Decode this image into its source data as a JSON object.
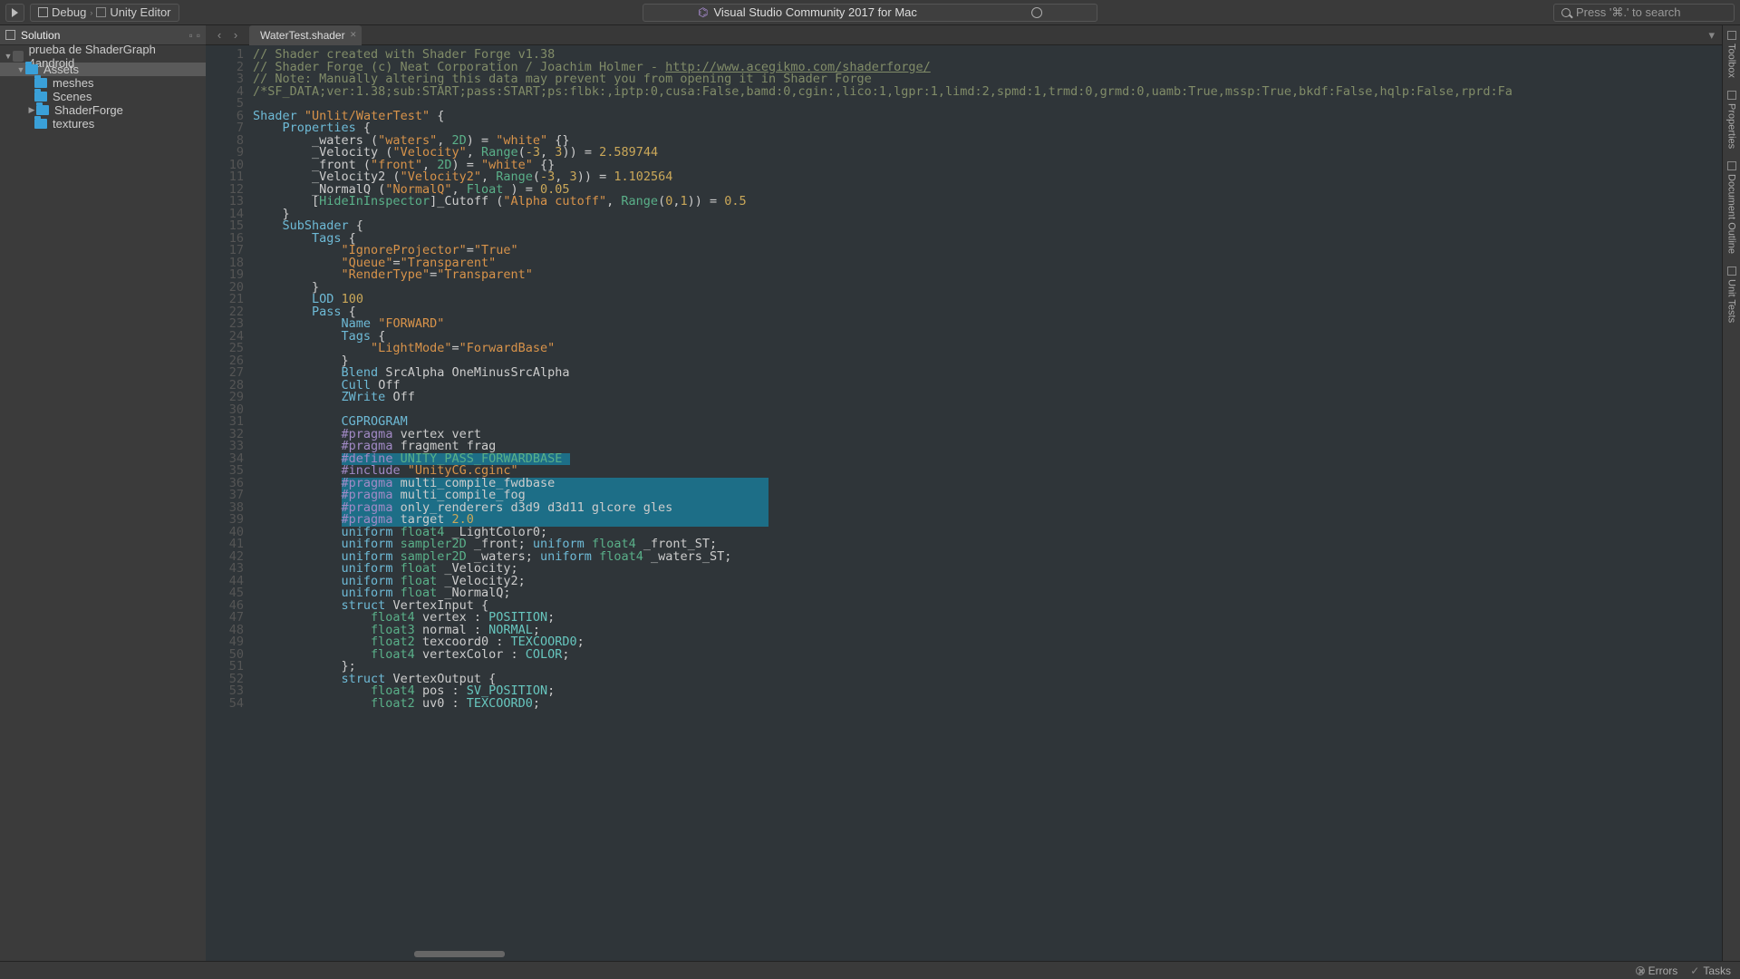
{
  "toolbar": {
    "debug_label": "Debug",
    "target_label": "Unity Editor",
    "app_title": "Visual Studio Community 2017 for Mac",
    "search_placeholder": "Press '⌘.' to search"
  },
  "solution": {
    "pane_title": "Solution",
    "project": "prueba de ShaderGraph 4android",
    "folders": [
      "Assets",
      "meshes",
      "Scenes",
      "ShaderForge",
      "textures"
    ]
  },
  "tab": {
    "filename": "WaterTest.shader"
  },
  "rail": {
    "items": [
      "Toolbox",
      "Properties",
      "Document Outline",
      "Unit Tests"
    ]
  },
  "status": {
    "errors": "Errors",
    "tasks": "Tasks"
  },
  "code": {
    "lines": [
      {
        "n": 1,
        "seg": [
          [
            "c",
            "// Shader created with Shader Forge v1.38 "
          ]
        ]
      },
      {
        "n": 2,
        "seg": [
          [
            "c",
            "// Shader Forge (c) Neat Corporation / Joachim Holmer - "
          ],
          [
            "cu",
            "http://www.acegikmo.com/shaderforge/"
          ]
        ]
      },
      {
        "n": 3,
        "seg": [
          [
            "c",
            "// Note: Manually altering this data may prevent you from opening it in Shader Forge"
          ]
        ]
      },
      {
        "n": 4,
        "seg": [
          [
            "c",
            "/*SF_DATA;ver:1.38;sub:START;pass:START;ps:flbk:,iptp:0,cusa:False,bamd:0,cgin:,lico:1,lgpr:1,limd:2,spmd:1,trmd:0,grmd:0,uamb:True,mssp:True,bkdf:False,hqlp:False,rprd:Fa"
          ]
        ]
      },
      {
        "n": 5,
        "seg": [
          [
            "",
            ""
          ]
        ]
      },
      {
        "n": 6,
        "seg": [
          [
            "k",
            "Shader"
          ],
          [
            "",
            " "
          ],
          [
            "s",
            "\"Unlit/WaterTest\""
          ],
          [
            "",
            " {"
          ]
        ]
      },
      {
        "n": 7,
        "seg": [
          [
            "",
            "    "
          ],
          [
            "k",
            "Properties"
          ],
          [
            "",
            " {"
          ]
        ]
      },
      {
        "n": 8,
        "seg": [
          [
            "",
            "        _waters ("
          ],
          [
            "s",
            "\"waters\""
          ],
          [
            "",
            ", "
          ],
          [
            "t",
            "2D"
          ],
          [
            "",
            ") = "
          ],
          [
            "s",
            "\"white\""
          ],
          [
            "",
            " {}"
          ]
        ]
      },
      {
        "n": 9,
        "seg": [
          [
            "",
            "        _Velocity ("
          ],
          [
            "s",
            "\"Velocity\""
          ],
          [
            "",
            ", "
          ],
          [
            "t",
            "Range"
          ],
          [
            "",
            "("
          ],
          [
            "n",
            "-3"
          ],
          [
            "",
            ", "
          ],
          [
            "n",
            "3"
          ],
          [
            "",
            ")) = "
          ],
          [
            "n",
            "2.589744"
          ]
        ]
      },
      {
        "n": 10,
        "seg": [
          [
            "",
            "        _front ("
          ],
          [
            "s",
            "\"front\""
          ],
          [
            "",
            ", "
          ],
          [
            "t",
            "2D"
          ],
          [
            "",
            ") = "
          ],
          [
            "s",
            "\"white\""
          ],
          [
            "",
            " {}"
          ]
        ]
      },
      {
        "n": 11,
        "seg": [
          [
            "",
            "        _Velocity2 ("
          ],
          [
            "s",
            "\"Velocity2\""
          ],
          [
            "",
            ", "
          ],
          [
            "t",
            "Range"
          ],
          [
            "",
            "("
          ],
          [
            "n",
            "-3"
          ],
          [
            "",
            ", "
          ],
          [
            "n",
            "3"
          ],
          [
            "",
            ")) = "
          ],
          [
            "n",
            "1.102564"
          ]
        ]
      },
      {
        "n": 12,
        "seg": [
          [
            "",
            "        _NormalQ ("
          ],
          [
            "s",
            "\"NormalQ\""
          ],
          [
            "",
            ", "
          ],
          [
            "t",
            "Float"
          ],
          [
            "",
            " ) = "
          ],
          [
            "n",
            "0.05"
          ]
        ]
      },
      {
        "n": 13,
        "seg": [
          [
            "",
            "        ["
          ],
          [
            "t",
            "HideInInspector"
          ],
          [
            "",
            "]_Cutoff ("
          ],
          [
            "s",
            "\"Alpha cutoff\""
          ],
          [
            "",
            ", "
          ],
          [
            "t",
            "Range"
          ],
          [
            "",
            "("
          ],
          [
            "n",
            "0"
          ],
          [
            "",
            ","
          ],
          [
            "n",
            "1"
          ],
          [
            "",
            ")) = "
          ],
          [
            "n",
            "0.5"
          ]
        ]
      },
      {
        "n": 14,
        "seg": [
          [
            "",
            "    }"
          ]
        ]
      },
      {
        "n": 15,
        "seg": [
          [
            "",
            "    "
          ],
          [
            "k",
            "SubShader"
          ],
          [
            "",
            " {"
          ]
        ]
      },
      {
        "n": 16,
        "seg": [
          [
            "",
            "        "
          ],
          [
            "k",
            "Tags"
          ],
          [
            "",
            " {"
          ]
        ]
      },
      {
        "n": 17,
        "seg": [
          [
            "",
            "            "
          ],
          [
            "s",
            "\"IgnoreProjector\""
          ],
          [
            "",
            "="
          ],
          [
            "s",
            "\"True\""
          ]
        ]
      },
      {
        "n": 18,
        "seg": [
          [
            "",
            "            "
          ],
          [
            "s",
            "\"Queue\""
          ],
          [
            "",
            "="
          ],
          [
            "s",
            "\"Transparent\""
          ]
        ]
      },
      {
        "n": 19,
        "seg": [
          [
            "",
            "            "
          ],
          [
            "s",
            "\"RenderType\""
          ],
          [
            "",
            "="
          ],
          [
            "s",
            "\"Transparent\""
          ]
        ]
      },
      {
        "n": 20,
        "seg": [
          [
            "",
            "        }"
          ]
        ]
      },
      {
        "n": 21,
        "seg": [
          [
            "",
            "        "
          ],
          [
            "k",
            "LOD"
          ],
          [
            "",
            " "
          ],
          [
            "n",
            "100"
          ]
        ]
      },
      {
        "n": 22,
        "seg": [
          [
            "",
            "        "
          ],
          [
            "k",
            "Pass"
          ],
          [
            "",
            " {"
          ]
        ]
      },
      {
        "n": 23,
        "seg": [
          [
            "",
            "            "
          ],
          [
            "k",
            "Name"
          ],
          [
            "",
            " "
          ],
          [
            "s",
            "\"FORWARD\""
          ]
        ]
      },
      {
        "n": 24,
        "seg": [
          [
            "",
            "            "
          ],
          [
            "k",
            "Tags"
          ],
          [
            "",
            " {"
          ]
        ]
      },
      {
        "n": 25,
        "seg": [
          [
            "",
            "                "
          ],
          [
            "s",
            "\"LightMode\""
          ],
          [
            "",
            "="
          ],
          [
            "s",
            "\"ForwardBase\""
          ]
        ]
      },
      {
        "n": 26,
        "seg": [
          [
            "",
            "            }"
          ]
        ]
      },
      {
        "n": 27,
        "seg": [
          [
            "",
            "            "
          ],
          [
            "k",
            "Blend"
          ],
          [
            "",
            " SrcAlpha OneMinusSrcAlpha"
          ]
        ]
      },
      {
        "n": 28,
        "seg": [
          [
            "",
            "            "
          ],
          [
            "k",
            "Cull"
          ],
          [
            "",
            " Off"
          ]
        ]
      },
      {
        "n": 29,
        "seg": [
          [
            "",
            "            "
          ],
          [
            "k",
            "ZWrite"
          ],
          [
            "",
            " Off"
          ]
        ]
      },
      {
        "n": 30,
        "seg": [
          [
            "",
            "            "
          ]
        ]
      },
      {
        "n": 31,
        "seg": [
          [
            "",
            "            "
          ],
          [
            "k",
            "CGPROGRAM"
          ]
        ]
      },
      {
        "n": 32,
        "seg": [
          [
            "",
            "            "
          ],
          [
            "p",
            "#pragma"
          ],
          [
            "",
            " vertex vert"
          ]
        ]
      },
      {
        "n": 33,
        "seg": [
          [
            "",
            "            "
          ],
          [
            "p",
            "#pragma"
          ],
          [
            "",
            " fragment frag"
          ]
        ]
      },
      {
        "n": 34,
        "seg": [
          [
            "",
            "            "
          ],
          [
            "selstart",
            ""
          ],
          [
            "p",
            "#define"
          ],
          [
            "",
            " "
          ],
          [
            "t",
            "UNITY_PASS_FORWARDBASE"
          ],
          [
            "",
            " "
          ],
          [
            "selend",
            ""
          ]
        ]
      },
      {
        "n": 35,
        "seg": [
          [
            "",
            "            "
          ],
          [
            "p",
            "#include"
          ],
          [
            "",
            " "
          ],
          [
            "s",
            "\"UnityCG.cginc\""
          ]
        ]
      },
      {
        "n": 36,
        "seg": [
          [
            "",
            "            "
          ],
          [
            "selstart",
            ""
          ],
          [
            "p",
            "#pragma"
          ],
          [
            "",
            " multi_compile_fwdbase                             "
          ],
          [
            "selend",
            ""
          ]
        ]
      },
      {
        "n": 37,
        "seg": [
          [
            "",
            "            "
          ],
          [
            "selstart",
            ""
          ],
          [
            "p",
            "#pragma"
          ],
          [
            "",
            " multi_compile_fog                                 "
          ],
          [
            "selend",
            ""
          ]
        ]
      },
      {
        "n": 38,
        "seg": [
          [
            "",
            "            "
          ],
          [
            "selstart",
            ""
          ],
          [
            "p",
            "#pragma"
          ],
          [
            "",
            " only_renderers d3d9 d3d11 glcore gles             "
          ],
          [
            "selend",
            ""
          ]
        ]
      },
      {
        "n": 39,
        "seg": [
          [
            "",
            "            "
          ],
          [
            "selstart",
            ""
          ],
          [
            "p",
            "#pragma"
          ],
          [
            "",
            " target "
          ],
          [
            "n",
            "2.0"
          ],
          [
            "",
            "                                        "
          ],
          [
            "selend",
            ""
          ]
        ]
      },
      {
        "n": 40,
        "seg": [
          [
            "",
            "            "
          ],
          [
            "k",
            "uniform"
          ],
          [
            "",
            " "
          ],
          [
            "t",
            "float4"
          ],
          [
            "",
            " _LightColor0;"
          ]
        ]
      },
      {
        "n": 41,
        "seg": [
          [
            "",
            "            "
          ],
          [
            "k",
            "uniform"
          ],
          [
            "",
            " "
          ],
          [
            "t",
            "sampler2D"
          ],
          [
            "",
            " _front; "
          ],
          [
            "k",
            "uniform"
          ],
          [
            "",
            " "
          ],
          [
            "t",
            "float4"
          ],
          [
            "",
            " _front_ST;"
          ]
        ]
      },
      {
        "n": 42,
        "seg": [
          [
            "",
            "            "
          ],
          [
            "k",
            "uniform"
          ],
          [
            "",
            " "
          ],
          [
            "t",
            "sampler2D"
          ],
          [
            "",
            " _waters; "
          ],
          [
            "k",
            "uniform"
          ],
          [
            "",
            " "
          ],
          [
            "t",
            "float4"
          ],
          [
            "",
            " _waters_ST;"
          ]
        ]
      },
      {
        "n": 43,
        "seg": [
          [
            "",
            "            "
          ],
          [
            "k",
            "uniform"
          ],
          [
            "",
            " "
          ],
          [
            "t",
            "float"
          ],
          [
            "",
            " _Velocity;"
          ]
        ]
      },
      {
        "n": 44,
        "seg": [
          [
            "",
            "            "
          ],
          [
            "k",
            "uniform"
          ],
          [
            "",
            " "
          ],
          [
            "t",
            "float"
          ],
          [
            "",
            " _Velocity2;"
          ]
        ]
      },
      {
        "n": 45,
        "seg": [
          [
            "",
            "            "
          ],
          [
            "k",
            "uniform"
          ],
          [
            "",
            " "
          ],
          [
            "t",
            "float"
          ],
          [
            "",
            " _NormalQ;"
          ]
        ]
      },
      {
        "n": 46,
        "seg": [
          [
            "",
            "            "
          ],
          [
            "k",
            "struct"
          ],
          [
            "",
            " VertexInput {"
          ]
        ]
      },
      {
        "n": 47,
        "seg": [
          [
            "",
            "                "
          ],
          [
            "t",
            "float4"
          ],
          [
            "",
            " vertex : "
          ],
          [
            "sm",
            "POSITION"
          ],
          [
            "",
            ";"
          ]
        ]
      },
      {
        "n": 48,
        "seg": [
          [
            "",
            "                "
          ],
          [
            "t",
            "float3"
          ],
          [
            "",
            " normal : "
          ],
          [
            "sm",
            "NORMAL"
          ],
          [
            "",
            ";"
          ]
        ]
      },
      {
        "n": 49,
        "seg": [
          [
            "",
            "                "
          ],
          [
            "t",
            "float2"
          ],
          [
            "",
            " texcoord0 : "
          ],
          [
            "sm",
            "TEXCOORD0"
          ],
          [
            "",
            ";"
          ]
        ]
      },
      {
        "n": 50,
        "seg": [
          [
            "",
            "                "
          ],
          [
            "t",
            "float4"
          ],
          [
            "",
            " vertexColor : "
          ],
          [
            "sm",
            "COLOR"
          ],
          [
            "",
            ";"
          ]
        ]
      },
      {
        "n": 51,
        "seg": [
          [
            "",
            "            };"
          ]
        ]
      },
      {
        "n": 52,
        "seg": [
          [
            "",
            "            "
          ],
          [
            "k",
            "struct"
          ],
          [
            "",
            " VertexOutput {"
          ]
        ]
      },
      {
        "n": 53,
        "seg": [
          [
            "",
            "                "
          ],
          [
            "t",
            "float4"
          ],
          [
            "",
            " pos : "
          ],
          [
            "sm",
            "SV_POSITION"
          ],
          [
            "",
            ";"
          ]
        ]
      },
      {
        "n": 54,
        "seg": [
          [
            "",
            "                "
          ],
          [
            "t",
            "float2"
          ],
          [
            "",
            " uv0 : "
          ],
          [
            "sm",
            "TEXCOORD0"
          ],
          [
            "",
            ";"
          ]
        ]
      }
    ]
  }
}
